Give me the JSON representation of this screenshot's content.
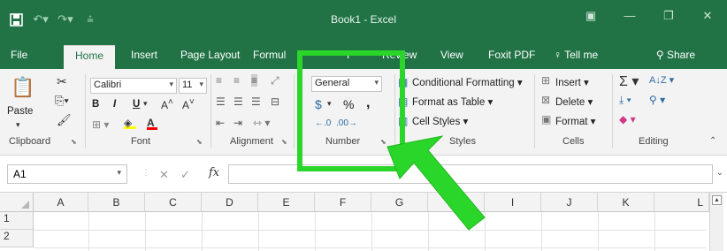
{
  "window": {
    "title": "Book1 - Excel",
    "ribbon_display_icon": "ribbon-display-icon",
    "min": "—",
    "restore": "❐",
    "close": "✕"
  },
  "tabs": [
    "File",
    "Home",
    "Insert",
    "Page Layout",
    "Formul",
    "F",
    "Review",
    "View",
    "Foxit PDF",
    "Tell me"
  ],
  "share": "Share",
  "ribbon": {
    "clipboard": {
      "label": "Clipboard",
      "paste": "Paste"
    },
    "font": {
      "label": "Font",
      "name": "Calibri",
      "size": "11",
      "bold": "B",
      "italic": "I",
      "underline": "U"
    },
    "alignment": {
      "label": "Alignment"
    },
    "number": {
      "label": "Number",
      "format": "General",
      "currency": "$",
      "percent": "%",
      "comma": ",",
      "inc_dec": ".00",
      "dec_dec": ".00"
    },
    "styles": {
      "label": "Styles",
      "conditional": "Conditional Formatting",
      "table": "Format as Table",
      "cell": "Cell Styles"
    },
    "cells": {
      "label": "Cells",
      "insert": "Insert",
      "delete": "Delete",
      "format": "Format"
    },
    "editing": {
      "label": "Editing"
    }
  },
  "formula_bar": {
    "name_box": "A1",
    "fx": "fx",
    "value": ""
  },
  "grid": {
    "columns": [
      "A",
      "B",
      "C",
      "D",
      "E",
      "F",
      "G",
      "H",
      "I",
      "J",
      "K",
      "L"
    ],
    "rows": [
      "1",
      "2"
    ]
  },
  "annotation": {
    "highlight_color": "#2ad62a",
    "highlight_target": "Number group",
    "arrow_color": "#2ad62a"
  },
  "colors": {
    "excel_green": "#217346",
    "ribbon_bg": "#f3f3f3"
  }
}
